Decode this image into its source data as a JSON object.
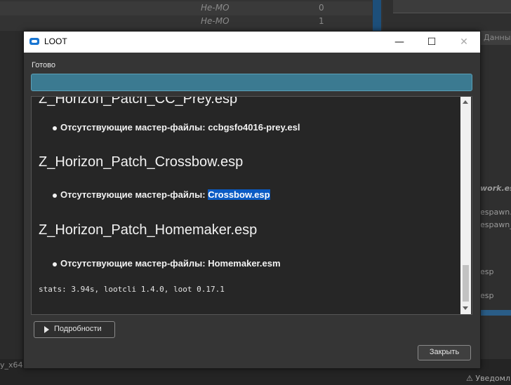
{
  "background": {
    "rows": [
      {
        "name": "Не-МО",
        "value": "0"
      },
      {
        "name": "Не-МО",
        "value": "1"
      }
    ],
    "right_tab": "Данные",
    "right_text_1": "work.esm",
    "right_text_2": "espawn.e",
    "right_text_3": "espawn_D",
    "right_text_4": "esp",
    "right_text_5": "esp",
    "bottom_left": "y_x64:",
    "notifications": "Уведомл",
    "notifications_icon": "warning-icon"
  },
  "window": {
    "title": "LOOT",
    "minimize": "—",
    "maximize": "☐",
    "close": "✕"
  },
  "status": {
    "label": "Готово",
    "progress": 1.0
  },
  "report": {
    "entries": [
      {
        "plugin": "Z_Horizon_Patch_CC_Prey.esp",
        "message": "Отсутствующие мастер-файлы: ccbgsfo4016-prey.esl"
      },
      {
        "plugin": "Z_Horizon_Patch_Crossbow.esp",
        "message_prefix": "Отсутствующие мастер-файлы: ",
        "message_selected": "Crossbow.esp"
      },
      {
        "plugin": "Z_Horizon_Patch_Homemaker.esp",
        "message": "Отсутствующие мастер-файлы: Homemaker.esm"
      }
    ],
    "stats": "stats: 3.94s, lootcli 1.4.0, loot 0.17.1"
  },
  "buttons": {
    "details": "Подробности",
    "close": "Закрыть"
  },
  "colors": {
    "accent": "#0a5bc4",
    "progress": "#3b7a91",
    "title_icon": "#1976d2"
  }
}
